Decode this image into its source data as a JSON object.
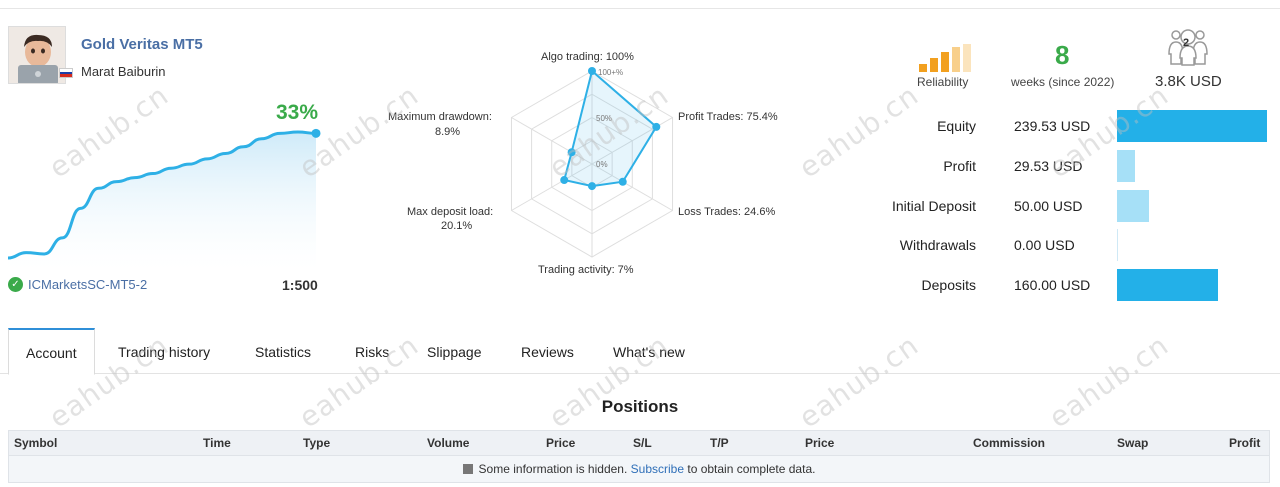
{
  "profile": {
    "title": "Gold Veritas MT5",
    "author": "Marat Baiburin",
    "flag_colors": [
      "#ffffff",
      "#1c3fa8",
      "#d52b1e"
    ]
  },
  "growth": {
    "value": "33%",
    "broker": "ICMarketsSC-MT5-2",
    "leverage": "1:500",
    "curve": [
      3,
      7,
      6,
      18,
      40,
      55,
      60,
      63,
      66,
      70,
      73,
      77,
      81,
      86,
      92,
      96,
      97,
      96
    ]
  },
  "radar": {
    "labels": {
      "algo": "Algo trading: 100%",
      "profit": "Profit Trades: 75.4%",
      "loss": "Loss Trades: 24.6%",
      "activity": "Trading activity: 7%",
      "deposit_load_1": "Max deposit load:",
      "deposit_load_2": "20.1%",
      "drawdown_1": "Maximum drawdown:",
      "drawdown_2": "8.9%"
    },
    "ticks": [
      "100+%",
      "50%",
      "0%"
    ],
    "values": [
      100,
      75.4,
      24.6,
      7,
      20.1,
      8.9
    ]
  },
  "stats": {
    "reliability_label": "Reliability",
    "weeks_value": "8",
    "weeks_label": "weeks (since 2022)",
    "subscribers_count": "2",
    "subscribers_value": "3.8K USD"
  },
  "balance": [
    {
      "label": "Equity",
      "value": "239.53 USD",
      "fraction": 1.0,
      "color": "#23b0e8"
    },
    {
      "label": "Profit",
      "value": "29.53 USD",
      "fraction": 0.12,
      "color": "#a6e0f7"
    },
    {
      "label": "Initial Deposit",
      "value": "50.00 USD",
      "fraction": 0.21,
      "color": "#a6e0f7"
    },
    {
      "label": "Withdrawals",
      "value": "0.00 USD",
      "fraction": 0.0,
      "color": "#a6e0f7"
    },
    {
      "label": "Deposits",
      "value": "160.00 USD",
      "fraction": 0.67,
      "color": "#23b0e8"
    }
  ],
  "tabs": [
    "Account",
    "Trading history",
    "Statistics",
    "Risks",
    "Slippage",
    "Reviews",
    "What's new"
  ],
  "positions": {
    "title": "Positions",
    "columns": [
      "Symbol",
      "Time",
      "Type",
      "Volume",
      "Price",
      "S/L",
      "T/P",
      "Price",
      "Commission",
      "Swap",
      "Profit"
    ],
    "info_text": "Some information is hidden.",
    "info_link": "Subscribe",
    "info_suffix": "to obtain complete data."
  },
  "watermark": "eahub.cn"
}
